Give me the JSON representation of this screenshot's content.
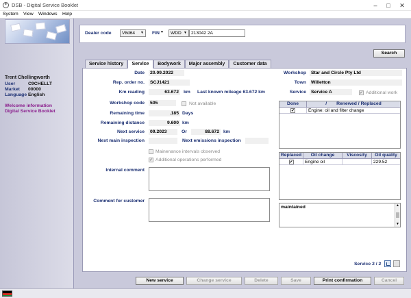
{
  "window": {
    "title": "DSB - Digital Service Booklet",
    "logo_symbol": "✦",
    "minimize_symbol": "–",
    "maximize_symbol": "□",
    "close_symbol": "✕"
  },
  "menu": [
    "System",
    "View",
    "Windows",
    "Help"
  ],
  "sidebar": {
    "name": "Trent Chellingworth",
    "fields": [
      {
        "label": "User",
        "value": "C9CHELLT"
      },
      {
        "label": "Market",
        "value": "00000"
      },
      {
        "label": "Language",
        "value": "English"
      }
    ],
    "links": [
      "Welcome information",
      "Digital Service Booklet"
    ]
  },
  "header": {
    "dealer_code_label": "Dealer code",
    "dealer_code_value": "V8d64",
    "fin_label": "FIN",
    "fin_type": "WDD",
    "fin_value": "213042 2A",
    "search_label": "Search"
  },
  "tabs": [
    "Service history",
    "Service",
    "Bodywork",
    "Major assembly",
    "Customer data"
  ],
  "active_tab": "Service",
  "form": {
    "date_label": "Date",
    "date_value": "20.09.2022",
    "rep_order_label": "Rep. order no.",
    "rep_order_value": "SCJ1421",
    "km_reading_label": "Km reading",
    "km_reading_value": "63.672",
    "km_unit": "km",
    "last_mileage_label": "Last known mileage 63.672 km",
    "workshop_code_label": "Workshop code",
    "workshop_code_value": "505",
    "not_available_label": "Not available",
    "remaining_time_label": "Remaining time",
    "remaining_time_value": ".185",
    "days_unit": "Days",
    "remaining_distance_label": "Remaining distance",
    "remaining_distance_value": "9.600",
    "remaining_distance_unit": "km",
    "next_service_label": "Next service",
    "next_service_date": "09.2023",
    "or_label": "Or",
    "next_service_km": "88.672",
    "next_service_unit": "km",
    "next_main_label": "Next main inspection",
    "next_emissions_label": "Next emissions inspection",
    "maint_observed_label": "Mainenance intervals observed",
    "additional_ops_label": "Additional operations performed",
    "check_mark": "✔",
    "internal_comment_label": "Internal comment",
    "customer_comment_label": "Comment for customer",
    "workshop_label": "Workshop",
    "workshop_value": "Star and Circle Pty Ltd",
    "town_label": "Town",
    "town_value": "Willetton",
    "service_label": "Service",
    "service_value": "Service A",
    "additional_work_label": "Additional work"
  },
  "done_table": {
    "headers": [
      "Done",
      "Renewed / Replaced"
    ],
    "sort_mark": "/",
    "rows": [
      {
        "done": "✔",
        "item": "Engine: oil and filter change"
      }
    ]
  },
  "oil_table": {
    "headers": [
      "Replaced",
      "Oil change",
      "Viscosity",
      "Oil quality"
    ],
    "rows": [
      {
        "replaced": "✔",
        "oil_change": "Engine oil",
        "viscosity": "",
        "quality": "229.52"
      }
    ]
  },
  "notes": {
    "text": "maintained",
    "scroll_up": "▲",
    "scroll_down": "▼"
  },
  "pager": {
    "label": "Service 2 / 2"
  },
  "buttons": {
    "new": "New service",
    "change": "Change service",
    "delete": "Delete",
    "save": "Save",
    "print": "Print confirmation",
    "cancel": "Cancel"
  }
}
